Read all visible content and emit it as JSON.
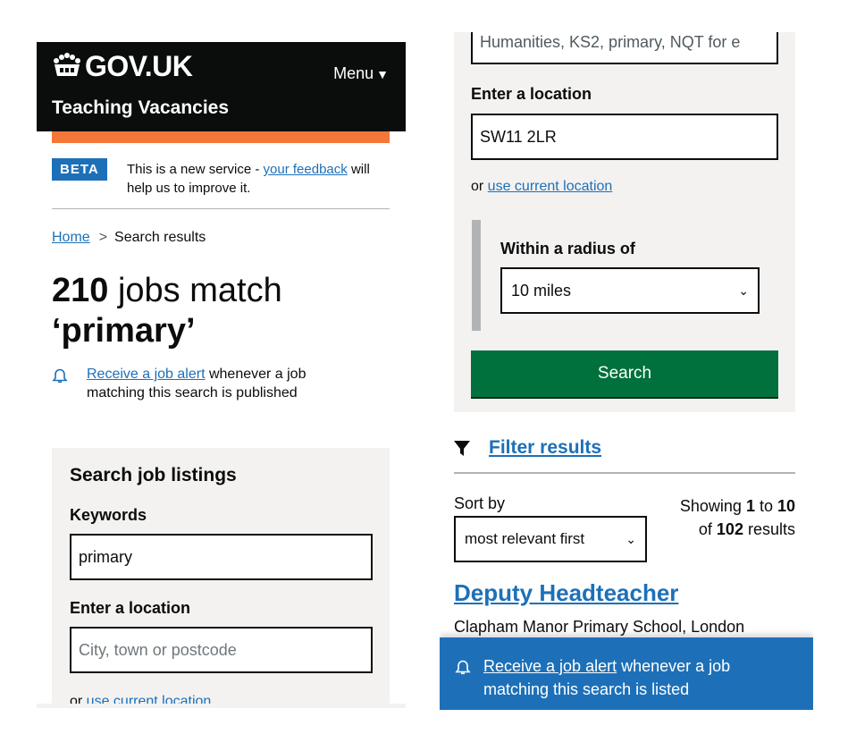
{
  "header": {
    "logo_text": "GOV.UK",
    "menu_label": "Menu",
    "service_name": "Teaching Vacancies"
  },
  "phase_banner": {
    "tag": "BETA",
    "text_before": "This is a new service - ",
    "feedback_link": "your feedback",
    "text_after": " will help us to improve it."
  },
  "breadcrumb": {
    "home": "Home",
    "current": "Search results"
  },
  "heading": {
    "count": "210",
    "middle": " jobs match",
    "query": "‘primary’"
  },
  "job_alert_left": {
    "link": "Receive a job alert",
    "text": " whenever a job matching this search is published"
  },
  "search_left": {
    "title": "Search job listings",
    "keywords_label": "Keywords",
    "keywords_value": "primary",
    "location_label": "Enter a location",
    "location_placeholder": "City, town or postcode",
    "or_text": "or ",
    "current_location_link": "use current location"
  },
  "search_right": {
    "keywords_value": "Humanities, KS2, primary, NQT for e",
    "location_label": "Enter a location",
    "location_value": "SW11 2LR",
    "or_text": "or ",
    "current_location_link": "use current location",
    "radius_label": "Within a radius of",
    "radius_selected": "10 miles",
    "search_button": "Search"
  },
  "filter": {
    "link": "Filter results"
  },
  "results": {
    "sort_label": "Sort by",
    "sort_selected": "most relevant first",
    "showing_prefix": "Showing ",
    "range_start": "1",
    "to": " to ",
    "range_end": "10",
    "of": "of ",
    "total": "102",
    "suffix": " results"
  },
  "job": {
    "title": "Deputy Headteacher",
    "school": "Clapham Manor Primary School, London"
  },
  "job_alert_bar": {
    "link": "Receive a job alert",
    "text": " whenever a job matching this search is listed"
  },
  "colors": {
    "header_bg": "#0b0c0c",
    "brand_orange": "#f47738",
    "link_blue": "#1d70b8",
    "button_green": "#00703c",
    "panel_grey": "#f3f2f1"
  },
  "icons": [
    "crown-icon",
    "chevron-down-icon",
    "bell-icon",
    "filter-icon"
  ]
}
